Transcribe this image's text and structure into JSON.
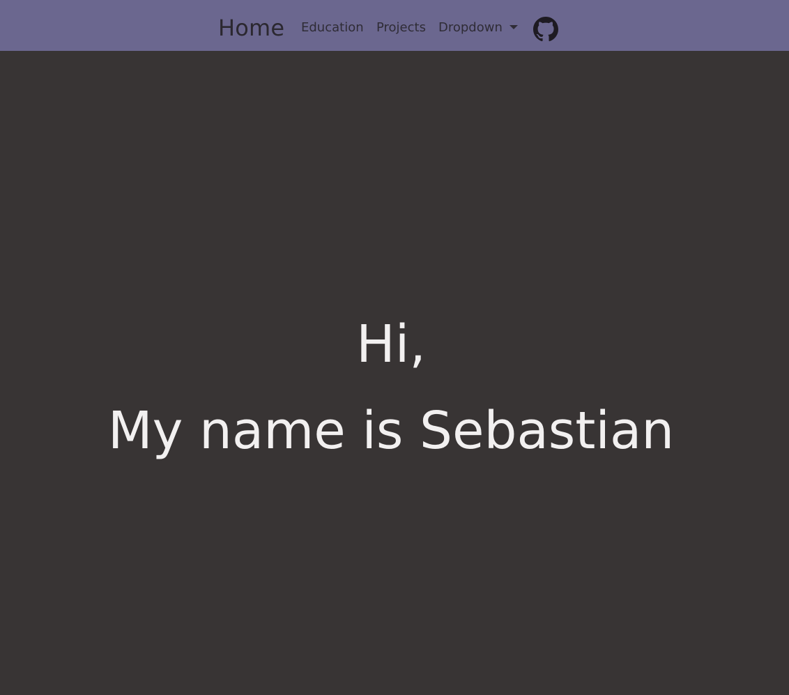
{
  "navbar": {
    "brand": "Home",
    "links": [
      {
        "label": "Education"
      },
      {
        "label": "Projects"
      },
      {
        "label": "Dropdown"
      }
    ],
    "github_icon": "github-icon",
    "background_color": "#6b678f"
  },
  "hero": {
    "line1": "Hi,",
    "line2": "My name is Sebastian",
    "background_color": "#383434",
    "text_color": "#f2f0f0"
  }
}
